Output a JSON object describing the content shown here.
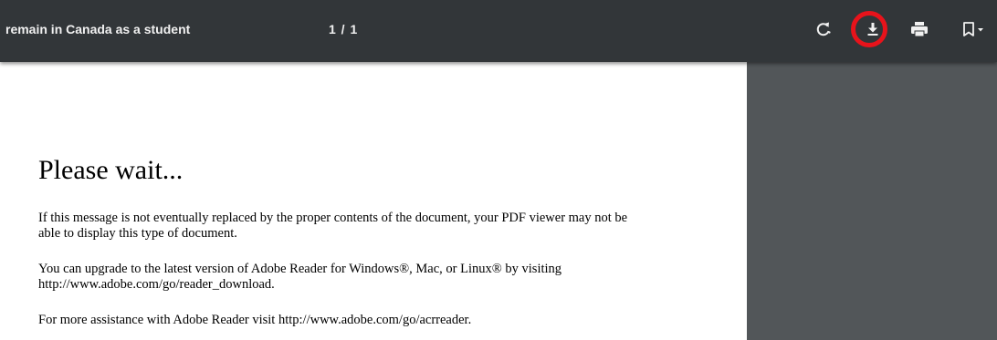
{
  "toolbar": {
    "title": "remain in Canada as a student",
    "page_indicator": "1 / 1",
    "buttons": {
      "rotate_icon": "rotate-icon",
      "download_icon": "download-icon",
      "print_icon": "print-icon",
      "bookmark_icon": "bookmark-icon"
    },
    "highlight_color": "#e8131b"
  },
  "document": {
    "heading": "Please wait...",
    "paragraphs": [
      "If this message is not eventually replaced by the proper contents of the document, your PDF viewer may not be able to display this type of document.",
      "You can upgrade to the latest version of Adobe Reader for Windows®, Mac, or Linux® by visiting  http://www.adobe.com/go/reader_download.",
      "For more assistance with Adobe Reader visit  http://www.adobe.com/go/acrreader."
    ]
  },
  "colors": {
    "toolbar_bg": "#323639",
    "viewer_bg": "#525659",
    "page_bg": "#ffffff"
  }
}
